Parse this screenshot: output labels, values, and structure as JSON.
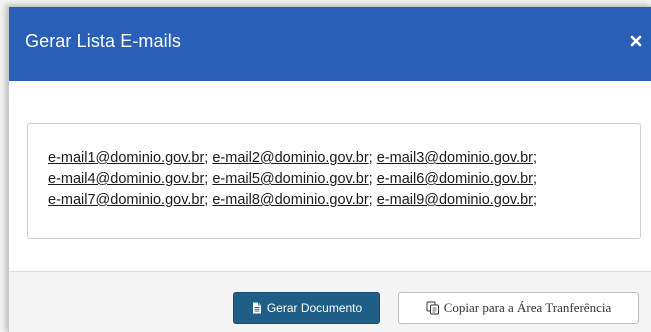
{
  "modal": {
    "title": "Gerar Lista E-mails",
    "close_icon": "close-icon"
  },
  "emails": {
    "lines": [
      [
        "e-mail1@dominio.gov.br",
        "e-mail2@dominio.gov.br",
        "e-mail3@dominio.gov.br"
      ],
      [
        "e-mail4@dominio.gov.br",
        "e-mail5@dominio.gov.br",
        "e-mail6@dominio.gov.br"
      ],
      [
        "e-mail7@dominio.gov.br",
        "e-mail8@dominio.gov.br",
        "e-mail9@dominio.gov.br"
      ]
    ],
    "separator": ";"
  },
  "footer": {
    "generate_label": "Gerar Documento",
    "generate_icon": "document-icon",
    "copy_label": "Copiar para a Área Tranferência",
    "copy_icon": "copy-icon"
  },
  "colors": {
    "header": "#2a5fb8",
    "primary_button": "#1f5f87"
  }
}
